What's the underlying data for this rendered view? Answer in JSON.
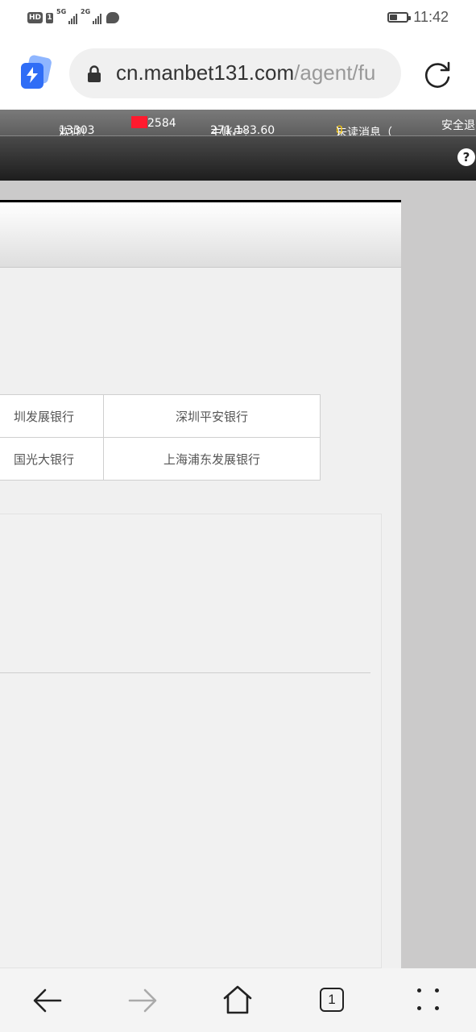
{
  "status_bar": {
    "hd": "HD",
    "sim": "1",
    "network1": "5G",
    "network2": "2G",
    "time": "11:42",
    "icons": [
      "signal-icon",
      "message-icon",
      "battery-icon"
    ]
  },
  "browser": {
    "url_host": "cn.manbet131.com",
    "url_path": "/agent/fu",
    "icons": [
      "bolt-icon",
      "lock-icon",
      "reload-icon"
    ]
  },
  "site_header": {
    "welcome_label": "欢迎!",
    "user_prefix": "13303",
    "user_suffix": "2584",
    "main_account_label": "主账户:",
    "main_account_value": "271,183.60",
    "unread_label": "未读消息（",
    "unread_count": "0",
    "unread_close": "）",
    "logout": "安全退",
    "help": "?"
  },
  "banks": [
    [
      "圳发展银行",
      "深圳平安银行"
    ],
    [
      "国光大银行",
      "上海浦东发展银行"
    ]
  ],
  "bottom_nav": {
    "tab_count": "1",
    "icons": [
      "back-arrow-icon",
      "forward-arrow-icon",
      "home-icon",
      "tabs-icon",
      "menu-dots-icon"
    ]
  },
  "colors": {
    "header_strip": "#6b6b6b",
    "nav_bar": "#2a2a2a",
    "unread_count": "#f3c100",
    "redaction": "#ff1a2e",
    "page_bg": "#cbcaca",
    "panel_bg": "#f0f0f0"
  }
}
